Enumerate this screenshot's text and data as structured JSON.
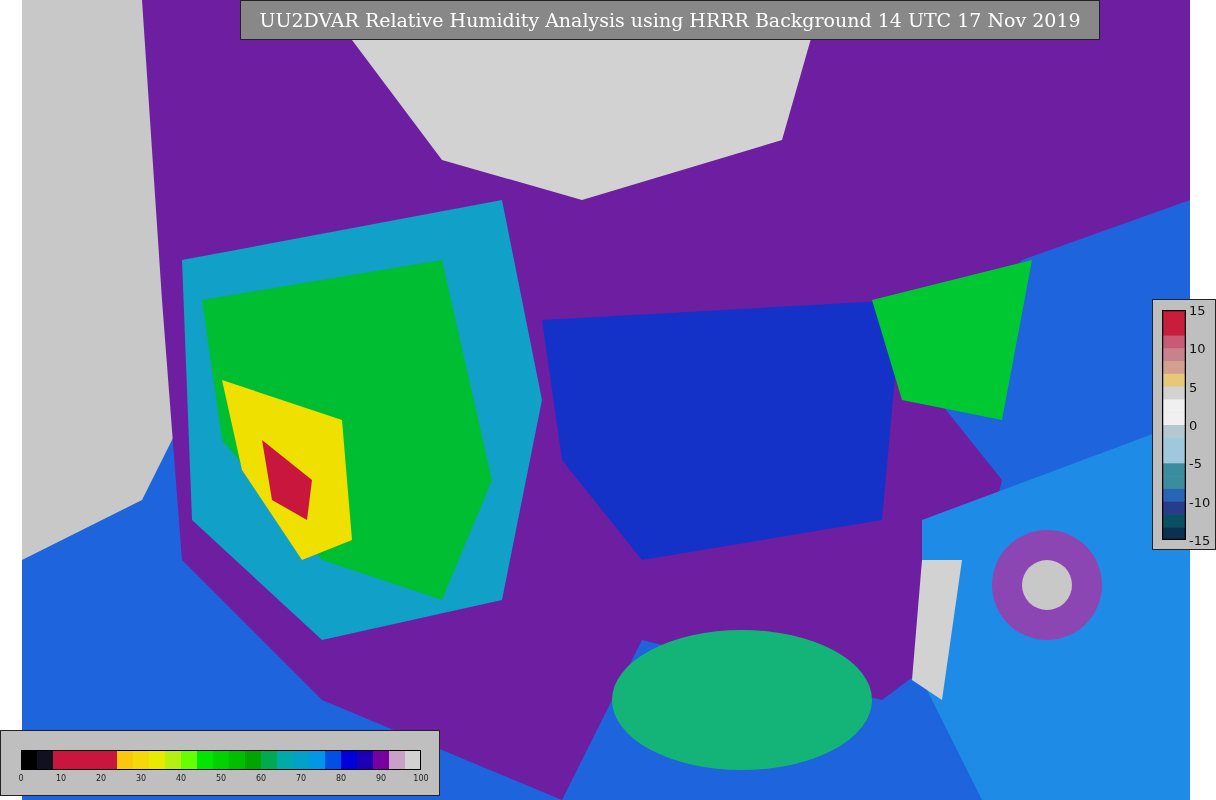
{
  "title": "UU2DVAR Relative Humidity Analysis using HRRR Background 14 UTC 17 Nov 2019",
  "humidity_colorbar": {
    "ticks": [
      "0",
      "10",
      "20",
      "30",
      "40",
      "50",
      "60",
      "70",
      "80",
      "90",
      "100"
    ]
  },
  "increment_colorbar": {
    "ticks": [
      "15",
      "10",
      "5",
      "0",
      "-5",
      "-10",
      "-15"
    ]
  }
}
